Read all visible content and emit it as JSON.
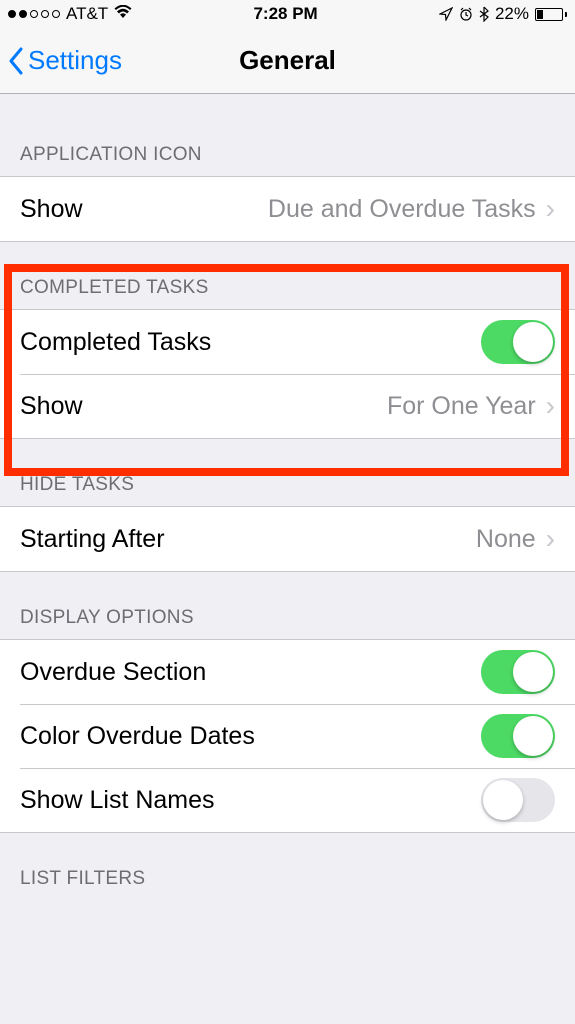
{
  "status": {
    "signal_filled": 2,
    "signal_total": 5,
    "carrier": "AT&T",
    "time": "7:28 PM",
    "battery_pct": "22%"
  },
  "nav": {
    "back_label": "Settings",
    "title": "General"
  },
  "sections": {
    "app_icon": {
      "header": "APPLICATION ICON",
      "show_label": "Show",
      "show_value": "Due and Overdue Tasks"
    },
    "completed": {
      "header": "COMPLETED TASKS",
      "toggle_label": "Completed Tasks",
      "toggle_on": true,
      "show_label": "Show",
      "show_value": "For One Year"
    },
    "hide": {
      "header": "HIDE TASKS",
      "starting_label": "Starting After",
      "starting_value": "None"
    },
    "display": {
      "header": "DISPLAY OPTIONS",
      "overdue_label": "Overdue Section",
      "overdue_on": true,
      "color_label": "Color Overdue Dates",
      "color_on": true,
      "listnames_label": "Show List Names",
      "listnames_on": false
    },
    "filters": {
      "header": "LIST FILTERS"
    }
  }
}
